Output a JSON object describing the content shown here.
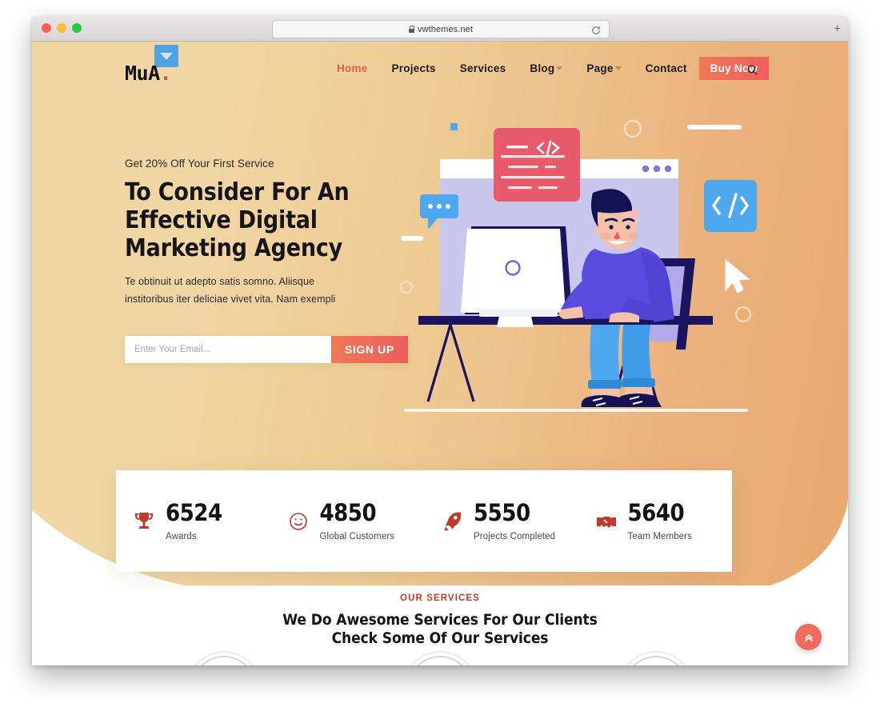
{
  "browser": {
    "url": "vwthemes.net",
    "lock_icon": "lock-icon",
    "reload_icon": "reload-icon",
    "new_tab_label": "+",
    "traffic_lights": [
      "close",
      "minimize",
      "zoom"
    ]
  },
  "site": {
    "logo_text": "MuA",
    "logo_dot": ".",
    "logo_badge_icon": "dropdown-triangle-icon"
  },
  "nav": {
    "items": [
      {
        "label": "Home",
        "active": true,
        "has_caret": false
      },
      {
        "label": "Projects",
        "active": false,
        "has_caret": false
      },
      {
        "label": "Services",
        "active": false,
        "has_caret": false
      },
      {
        "label": "Blog",
        "active": false,
        "has_caret": true
      },
      {
        "label": "Page",
        "active": false,
        "has_caret": true
      },
      {
        "label": "Contact",
        "active": false,
        "has_caret": false
      }
    ],
    "buy_now_label": "Buy Now",
    "search_icon": "search-icon"
  },
  "hero": {
    "eyebrow": "Get 20% Off Your First Service",
    "title_line1": "To Consider For An",
    "title_line2": "Effective Digital",
    "title_line3": "Marketing Agency",
    "subtitle_line1": "Te obtinuit ut adepto satis somno. Aliisque",
    "subtitle_line2": "institoribus iter deliciae vivet vita. Nam exempli",
    "email_placeholder": "Enter Your Email...",
    "email_value": "",
    "signup_label": "SIGN UP"
  },
  "stats": [
    {
      "icon": "trophy-icon",
      "number": "6524",
      "label": "Awards"
    },
    {
      "icon": "smiley-icon",
      "number": "4850",
      "label": "Global Customers"
    },
    {
      "icon": "rocket-icon",
      "number": "5550",
      "label": "Projects Completed"
    },
    {
      "icon": "handshake-icon",
      "number": "5640",
      "label": "Team Members"
    }
  ],
  "services": {
    "eyebrow": "OUR SERVICES",
    "heading_line1": "We Do Awesome Services For Our Clients",
    "heading_line2": "Check Some Of Our Services",
    "cards": [
      {
        "icon": "sun-idea-icon"
      },
      {
        "icon": "briefcase-icon"
      },
      {
        "icon": "diamond-icon"
      }
    ]
  },
  "back_to_top": {
    "icon": "double-chevron-up-icon"
  },
  "colors": {
    "hero_gradient_start": "#f0d6a3",
    "hero_gradient_end": "#e9a96f",
    "accent_orange": "#e05f4a",
    "accent_red": "#c0392b",
    "button_gradient_start": "#ef7a55",
    "button_gradient_end": "#ee5d5d",
    "logo_badge_blue": "#4fa3e3",
    "illustration_navy": "#1b145e",
    "illustration_purple": "#5b4ae0",
    "illustration_blue": "#4ea8ef",
    "illustration_pink": "#e8596b",
    "illustration_lavender": "#c5c4ee"
  }
}
